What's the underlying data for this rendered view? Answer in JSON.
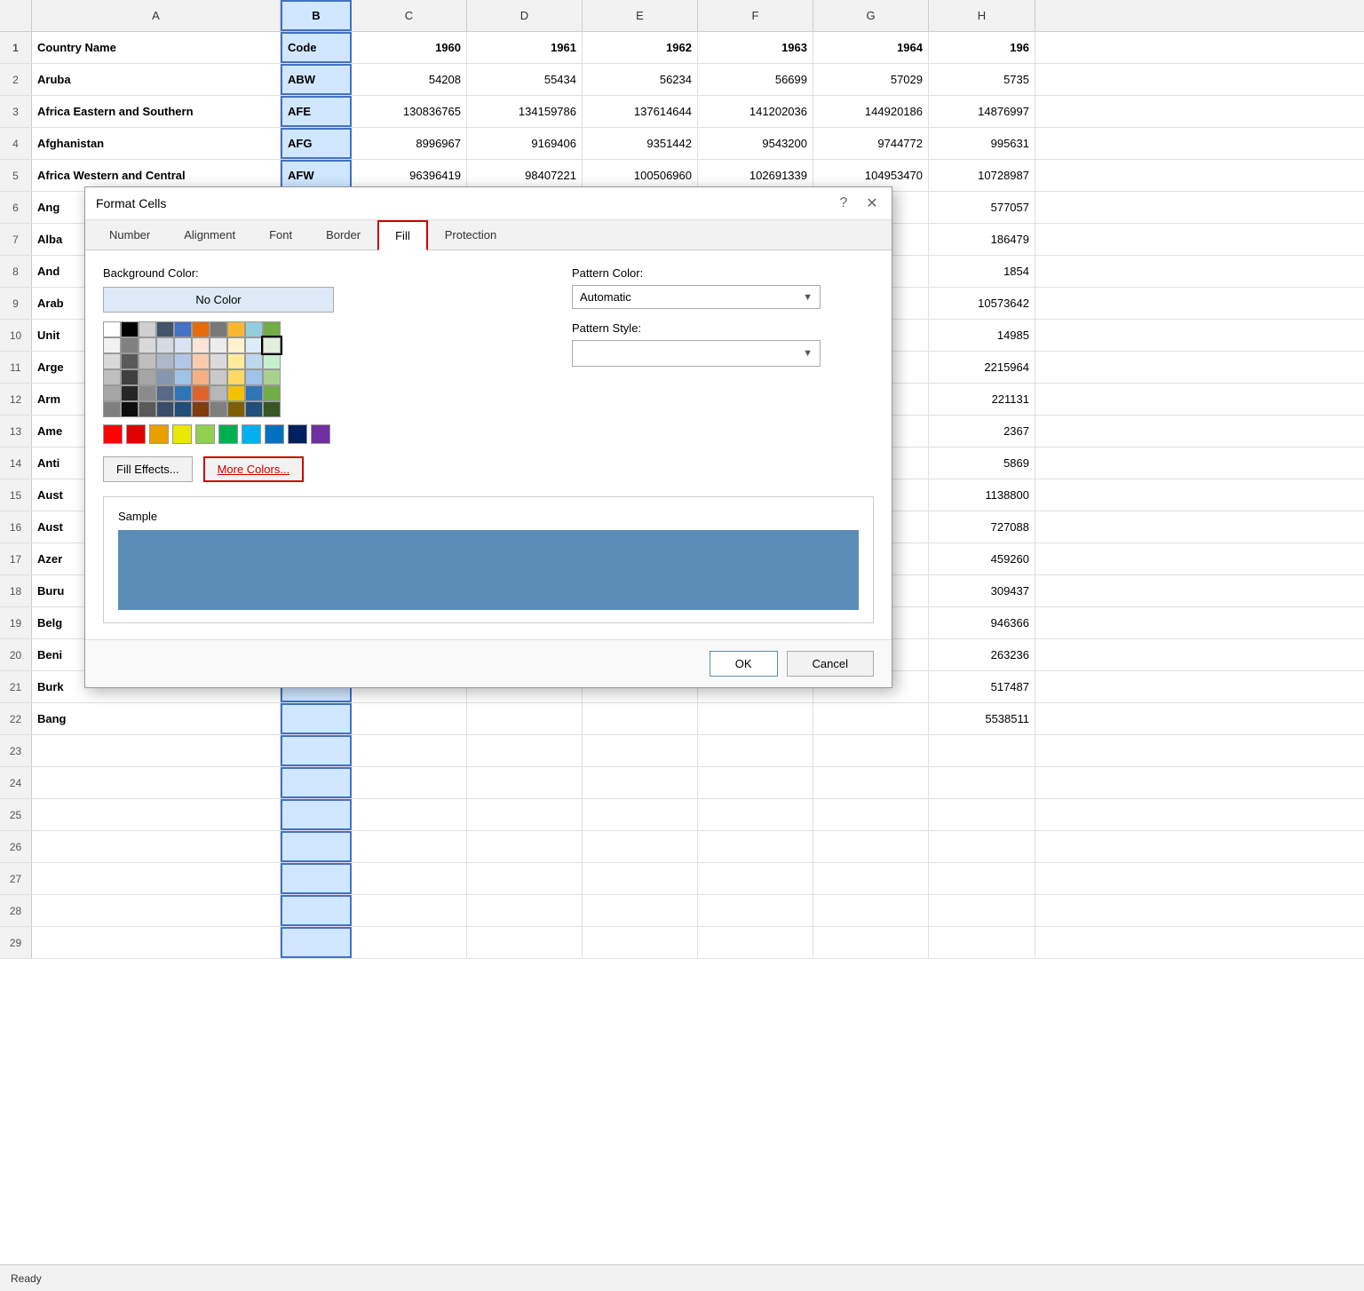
{
  "spreadsheet": {
    "columns": [
      "",
      "A",
      "B",
      "C",
      "D",
      "E",
      "F",
      "G",
      "H"
    ],
    "rows": [
      {
        "num": "1",
        "a": "Country Name",
        "b": "Code",
        "c": "1960",
        "d": "1961",
        "e": "1962",
        "f": "1963",
        "g": "1964",
        "h": "196"
      },
      {
        "num": "2",
        "a": "Aruba",
        "b": "ABW",
        "c": "54208",
        "d": "55434",
        "e": "56234",
        "f": "56699",
        "g": "57029",
        "h": "5735"
      },
      {
        "num": "3",
        "a": "Africa Eastern and Southern",
        "b": "AFE",
        "c": "130836765",
        "d": "134159786",
        "e": "137614644",
        "f": "141202036",
        "g": "144920186",
        "h": "14876997"
      },
      {
        "num": "4",
        "a": "Afghanistan",
        "b": "AFG",
        "c": "8996967",
        "d": "9169406",
        "e": "9351442",
        "f": "9543200",
        "g": "9744772",
        "h": "995631"
      },
      {
        "num": "5",
        "a": "Africa Western and Central",
        "b": "AFW",
        "c": "96396419",
        "d": "98407221",
        "e": "100506960",
        "f": "102691339",
        "g": "104953470",
        "h": "10728987"
      },
      {
        "num": "6",
        "a": "Ang",
        "b": "",
        "c": "",
        "d": "",
        "e": "",
        "f": "",
        "g": "",
        "h": "577057"
      },
      {
        "num": "7",
        "a": "Alba",
        "b": "",
        "c": "",
        "d": "",
        "e": "",
        "f": "",
        "g": "",
        "h": "186479"
      },
      {
        "num": "8",
        "a": "And",
        "b": "",
        "c": "",
        "d": "",
        "e": "",
        "f": "",
        "g": "",
        "h": "1854"
      },
      {
        "num": "9",
        "a": "Arab",
        "b": "",
        "c": "",
        "d": "",
        "e": "",
        "f": "",
        "g": "",
        "h": "10573642"
      },
      {
        "num": "10",
        "a": "Unit",
        "b": "",
        "c": "",
        "d": "",
        "e": "",
        "f": "",
        "g": "",
        "h": "14985"
      },
      {
        "num": "11",
        "a": "Arge",
        "b": "",
        "c": "",
        "d": "",
        "e": "",
        "f": "",
        "g": "",
        "h": "2215964"
      },
      {
        "num": "12",
        "a": "Arm",
        "b": "",
        "c": "",
        "d": "",
        "e": "",
        "f": "",
        "g": "",
        "h": "221131"
      },
      {
        "num": "13",
        "a": "Ame",
        "b": "",
        "c": "",
        "d": "",
        "e": "",
        "f": "",
        "g": "",
        "h": "2367"
      },
      {
        "num": "14",
        "a": "Anti",
        "b": "",
        "c": "",
        "d": "",
        "e": "",
        "f": "",
        "g": "",
        "h": "5869"
      },
      {
        "num": "15",
        "a": "Aust",
        "b": "",
        "c": "",
        "d": "",
        "e": "",
        "f": "",
        "g": "",
        "h": "1138800"
      },
      {
        "num": "16",
        "a": "Aust",
        "b": "",
        "c": "",
        "d": "",
        "e": "",
        "f": "",
        "g": "",
        "h": "727088"
      },
      {
        "num": "17",
        "a": "Azer",
        "b": "",
        "c": "",
        "d": "",
        "e": "",
        "f": "",
        "g": "",
        "h": "459260"
      },
      {
        "num": "18",
        "a": "Buru",
        "b": "",
        "c": "",
        "d": "",
        "e": "",
        "f": "",
        "g": "",
        "h": "309437"
      },
      {
        "num": "19",
        "a": "Belg",
        "b": "",
        "c": "",
        "d": "",
        "e": "",
        "f": "",
        "g": "",
        "h": "946366"
      },
      {
        "num": "20",
        "a": "Beni",
        "b": "",
        "c": "",
        "d": "",
        "e": "",
        "f": "",
        "g": "",
        "h": "263236"
      },
      {
        "num": "21",
        "a": "Burk",
        "b": "",
        "c": "",
        "d": "",
        "e": "",
        "f": "",
        "g": "",
        "h": "517487"
      },
      {
        "num": "22",
        "a": "Bang",
        "b": "",
        "c": "",
        "d": "",
        "e": "",
        "f": "",
        "g": "",
        "h": "5538511"
      },
      {
        "num": "23",
        "a": "",
        "b": "",
        "c": "",
        "d": "",
        "e": "",
        "f": "",
        "g": "",
        "h": ""
      },
      {
        "num": "24",
        "a": "",
        "b": "",
        "c": "",
        "d": "",
        "e": "",
        "f": "",
        "g": "",
        "h": ""
      },
      {
        "num": "25",
        "a": "",
        "b": "",
        "c": "",
        "d": "",
        "e": "",
        "f": "",
        "g": "",
        "h": ""
      },
      {
        "num": "26",
        "a": "",
        "b": "",
        "c": "",
        "d": "",
        "e": "",
        "f": "",
        "g": "",
        "h": ""
      },
      {
        "num": "27",
        "a": "",
        "b": "",
        "c": "",
        "d": "",
        "e": "",
        "f": "",
        "g": "",
        "h": ""
      },
      {
        "num": "28",
        "a": "",
        "b": "",
        "c": "",
        "d": "",
        "e": "",
        "f": "",
        "g": "",
        "h": ""
      },
      {
        "num": "29",
        "a": "",
        "b": "",
        "c": "",
        "d": "",
        "e": "",
        "f": "",
        "g": "",
        "h": ""
      }
    ]
  },
  "dialog": {
    "title": "Format Cells",
    "tabs": [
      "Number",
      "Alignment",
      "Font",
      "Border",
      "Fill",
      "Protection"
    ],
    "active_tab": "Fill",
    "fill": {
      "bg_color_label": "Background Color:",
      "no_color_label": "No Color",
      "pattern_color_label": "Pattern Color:",
      "pattern_color_value": "Automatic",
      "pattern_style_label": "Pattern Style:",
      "sample_label": "Sample",
      "fill_effects_label": "Fill Effects...",
      "more_colors_label": "More Colors...",
      "sample_color": "#5b8db8"
    },
    "footer": {
      "ok_label": "OK",
      "cancel_label": "Cancel"
    }
  },
  "status": {
    "text": "Ready"
  },
  "color_grid": {
    "row1": [
      "#ffffff",
      "#000000",
      "#d0cece",
      "#44546a",
      "#4472c4",
      "#e46c0a",
      "#787878",
      "#f9b731",
      "#92cddc",
      "#70ad47"
    ],
    "row2_col1": [
      "#f2f2f2",
      "#808080",
      "#d9d9d9",
      "#d6dce4",
      "#dae3f3",
      "#fce4d6",
      "#ededed",
      "#fff2cc",
      "#ddebf7",
      "#e2efda"
    ],
    "row2_col2": [
      "#d9d9d9",
      "#595959",
      "#bfbfbf",
      "#adb9ca",
      "#b4c6e7",
      "#f8cbad",
      "#dbdbdb",
      "#ffeb9c",
      "#bdd7ee",
      "#c6efce"
    ],
    "row2_col3": [
      "#bfbfbf",
      "#404040",
      "#a5a5a5",
      "#8496b0",
      "#9dc3e6",
      "#f4b183",
      "#c9c9c9",
      "#ffd966",
      "#9dc3e6",
      "#a9d18e"
    ],
    "row2_col4": [
      "#a5a5a5",
      "#262626",
      "#8b8b8b",
      "#586a88",
      "#2e75b6",
      "#e0622a",
      "#b7b7b7",
      "#f3c200",
      "#2e75b6",
      "#70ad47"
    ],
    "row2_col5": [
      "#7f7f7f",
      "#0d0d0d",
      "#595959",
      "#3a4d68",
      "#1f4e79",
      "#843c0c",
      "#7f7f7f",
      "#7f6000",
      "#1f4e79",
      "#375623"
    ],
    "vivid": [
      "#ff0000",
      "#e00000",
      "#e8a000",
      "#e8e800",
      "#92d050",
      "#00b050",
      "#00b0f0",
      "#0070c0",
      "#002060",
      "#7030a0"
    ]
  }
}
